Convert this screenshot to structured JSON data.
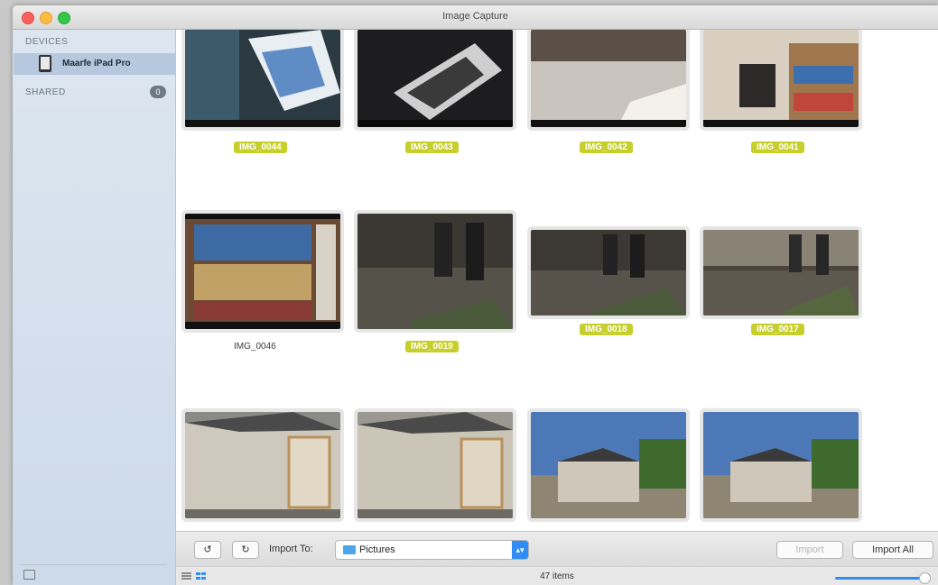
{
  "window": {
    "title": "Image Capture"
  },
  "sidebar": {
    "devices_header": "DEVICES",
    "device_name": "Maarfe iPad Pro",
    "shared_header": "SHARED",
    "shared_count": "0"
  },
  "photos": [
    {
      "name": "IMG_0044",
      "selected": true
    },
    {
      "name": "IMG_0043",
      "selected": true
    },
    {
      "name": "IMG_0042",
      "selected": true
    },
    {
      "name": "IMG_0041",
      "selected": true
    },
    {
      "name": "IMG_0046",
      "selected": false
    },
    {
      "name": "IMG_0019",
      "selected": true
    },
    {
      "name": "IMG_0018",
      "selected": true
    },
    {
      "name": "IMG_0017",
      "selected": true
    }
  ],
  "toolbar": {
    "import_to_label": "Import To:",
    "destination": "Pictures",
    "import_button": "Import",
    "import_all_button": "Import All"
  },
  "status": {
    "item_count": "47 items"
  },
  "colors": {
    "selection": "#c7cf2a",
    "accent": "#2f8df5"
  }
}
